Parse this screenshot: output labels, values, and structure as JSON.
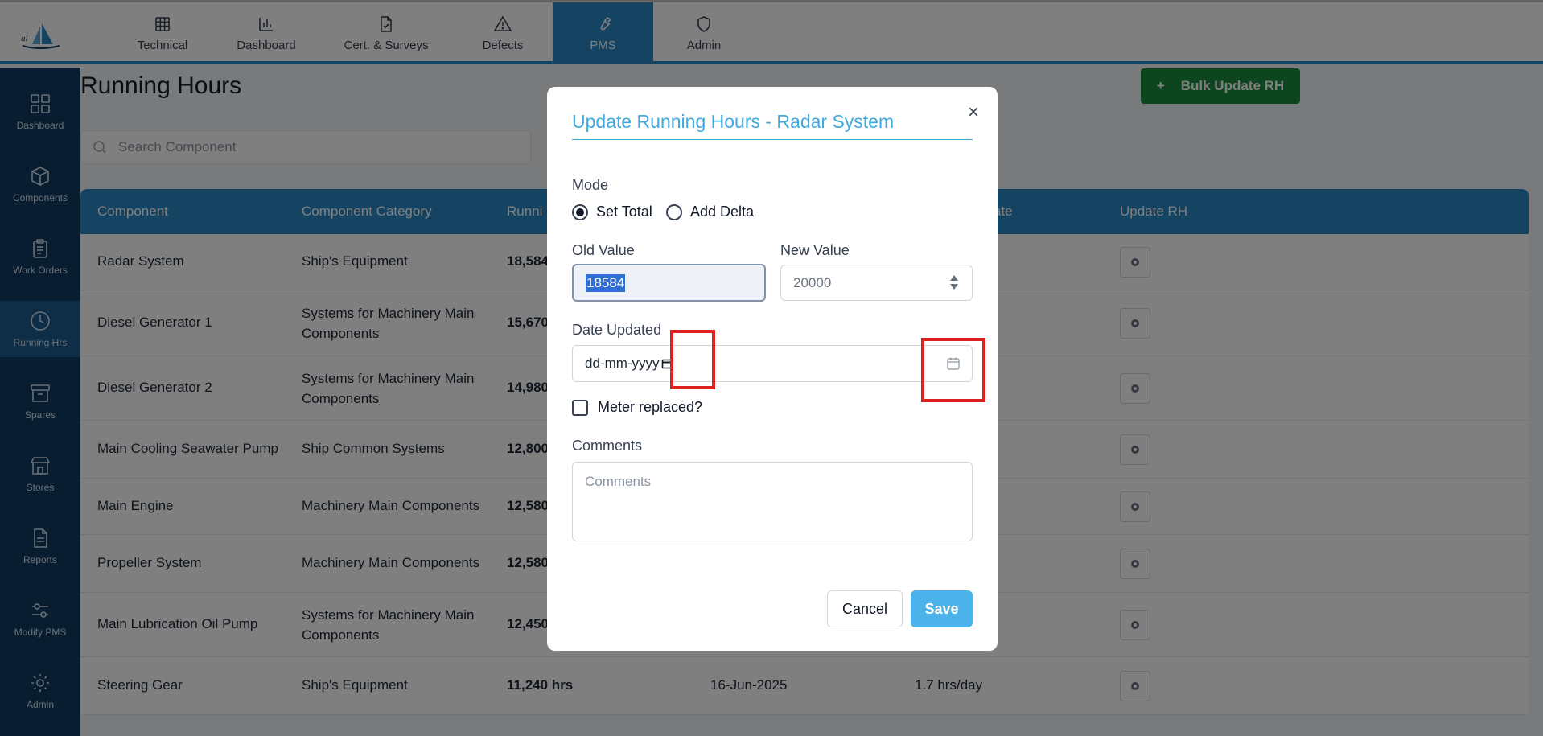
{
  "nav": {
    "tabs": [
      {
        "label": "Technical",
        "icon": "grid-icon"
      },
      {
        "label": "Dashboard",
        "icon": "bar-chart-icon"
      },
      {
        "label": "Cert. & Surveys",
        "icon": "document-icon"
      },
      {
        "label": "Defects",
        "icon": "warning-icon"
      },
      {
        "label": "PMS",
        "icon": "wrench-icon"
      },
      {
        "label": "Admin",
        "icon": "shield-icon"
      }
    ],
    "active_tab": "PMS"
  },
  "sidebar": {
    "items": [
      {
        "label": "Dashboard",
        "icon": "dashboard-icon"
      },
      {
        "label": "Components",
        "icon": "cube-icon"
      },
      {
        "label": "Work Orders",
        "icon": "clipboard-icon"
      },
      {
        "label": "Running Hrs",
        "icon": "clock-icon"
      },
      {
        "label": "Spares",
        "icon": "archive-icon"
      },
      {
        "label": "Stores",
        "icon": "store-icon"
      },
      {
        "label": "Reports",
        "icon": "report-icon"
      },
      {
        "label": "Modify PMS",
        "icon": "sliders-icon"
      },
      {
        "label": "Admin",
        "icon": "gear-icon"
      }
    ],
    "active_item": "Running Hrs"
  },
  "page": {
    "title": "Running Hours",
    "bulk_button_icon": "+",
    "bulk_button_label": "Bulk Update RH",
    "search_placeholder": "Search Component"
  },
  "table": {
    "headers": [
      "Component",
      "Component Category",
      "Runni",
      "ate",
      "Update RH"
    ],
    "rows": [
      {
        "component": "Radar System",
        "category": [
          "Ship's Equipment"
        ],
        "running": "18,584",
        "date": "",
        "avg": ""
      },
      {
        "component": "Diesel Generator 1",
        "category": [
          "Systems for Machinery Main",
          "Components"
        ],
        "running": "15,670",
        "date": "",
        "avg": ""
      },
      {
        "component": "Diesel Generator 2",
        "category": [
          "Systems for Machinery Main",
          "Components"
        ],
        "running": "14,980",
        "date": "",
        "avg": ""
      },
      {
        "component": "Main Cooling Seawater Pump",
        "category": [
          "Ship Common Systems"
        ],
        "running": "12,800",
        "date": "",
        "avg": ""
      },
      {
        "component": "Main Engine",
        "category": [
          "Machinery Main Components"
        ],
        "running": "12,580",
        "date": "",
        "avg": ""
      },
      {
        "component": "Propeller System",
        "category": [
          "Machinery Main Components"
        ],
        "running": "12,580",
        "date": "",
        "avg": ""
      },
      {
        "component": "Main Lubrication Oil Pump",
        "category": [
          "Systems for Machinery Main",
          "Components"
        ],
        "running": "12,450",
        "date": "",
        "avg": ""
      },
      {
        "component": "Steering Gear",
        "category": [
          "Ship's Equipment"
        ],
        "running": "11,240 hrs",
        "date": "16-Jun-2025",
        "avg": "1.7 hrs/day"
      }
    ]
  },
  "modal": {
    "title": "Update Running Hours - Radar System",
    "close": "×",
    "mode_label": "Mode",
    "mode_options": [
      "Set Total",
      "Add Delta"
    ],
    "mode_selected": "Set Total",
    "old_value_label": "Old Value",
    "old_value": "18584",
    "new_value_label": "New Value",
    "new_value_placeholder": "20000",
    "date_label": "Date Updated",
    "date_placeholder": "dd-mm-yyyy",
    "meter_replaced_label": "Meter replaced?",
    "meter_replaced_checked": false,
    "comments_label": "Comments",
    "comments_placeholder": "Comments",
    "cancel_label": "Cancel",
    "save_label": "Save"
  },
  "colors": {
    "accent": "#2b86c5",
    "sidebar": "#123b60",
    "title_blue": "#3fa9e0",
    "save_button": "#4bb3ea",
    "bulk_button": "#1a8a3c",
    "highlight": "#e01f1f"
  }
}
